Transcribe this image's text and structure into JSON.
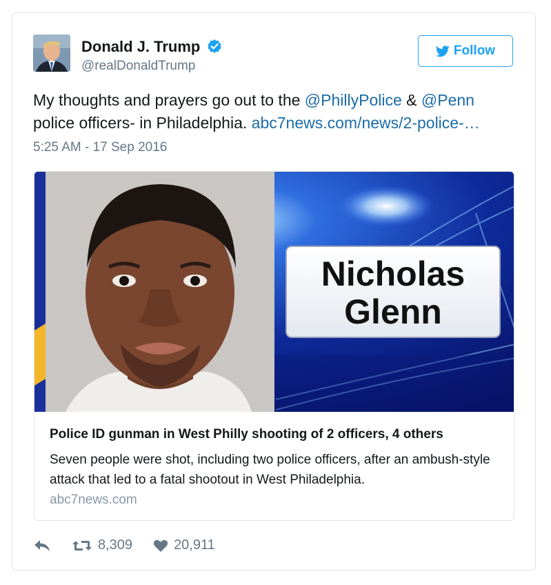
{
  "author": {
    "name": "Donald J. Trump",
    "handle": "@realDonaldTrump",
    "verified": true
  },
  "follow_button": {
    "label": "Follow"
  },
  "tweet": {
    "text_1": "My thoughts and prayers go out to the ",
    "mention_1": "@PhillyPolice",
    "text_2": " & ",
    "mention_2": "@Penn",
    "text_3": " police officers- in Philadelphia. ",
    "link": "abc7news.com/news/2-police-…",
    "timestamp": "5:25 AM - 17 Sep 2016"
  },
  "card": {
    "image_caption_line1": "Nicholas",
    "image_caption_line2": "Glenn",
    "title": "Police ID gunman in West Philly shooting of 2 officers, 4 others",
    "description": "Seven people were shot, including two police officers, after an ambush-style attack that led to a fatal shootout in West Philadelphia.",
    "domain": "abc7news.com"
  },
  "actions": {
    "retweets": "8,309",
    "likes": "20,911"
  },
  "colors": {
    "brand_blue": "#1da1f2",
    "link_blue": "#1b6ca8",
    "secondary_text": "#657786"
  }
}
